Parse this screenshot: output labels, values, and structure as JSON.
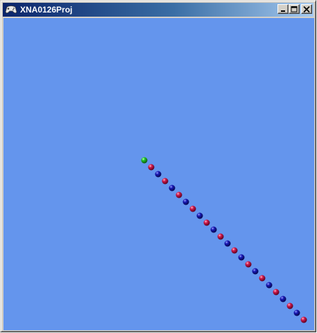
{
  "window": {
    "title": "XNA0126Proj",
    "app_icon": "xna-gamepad-icon",
    "buttons": {
      "minimize_icon": "minimize-icon",
      "maximize_icon": "maximize-icon",
      "close_icon": "close-icon"
    }
  },
  "game": {
    "background_color": "#6495ED",
    "sprite_count": 24,
    "sprite_colors": {
      "head": "#22c32a",
      "red": "#d21c4f",
      "blue": "#1a1ab8"
    },
    "sprites": [
      "head",
      "red",
      "blue",
      "red",
      "blue",
      "red",
      "blue",
      "red",
      "blue",
      "red",
      "blue",
      "red",
      "blue",
      "red",
      "blue",
      "red",
      "blue",
      "red",
      "blue",
      "red",
      "blue",
      "red",
      "blue",
      "red"
    ]
  }
}
